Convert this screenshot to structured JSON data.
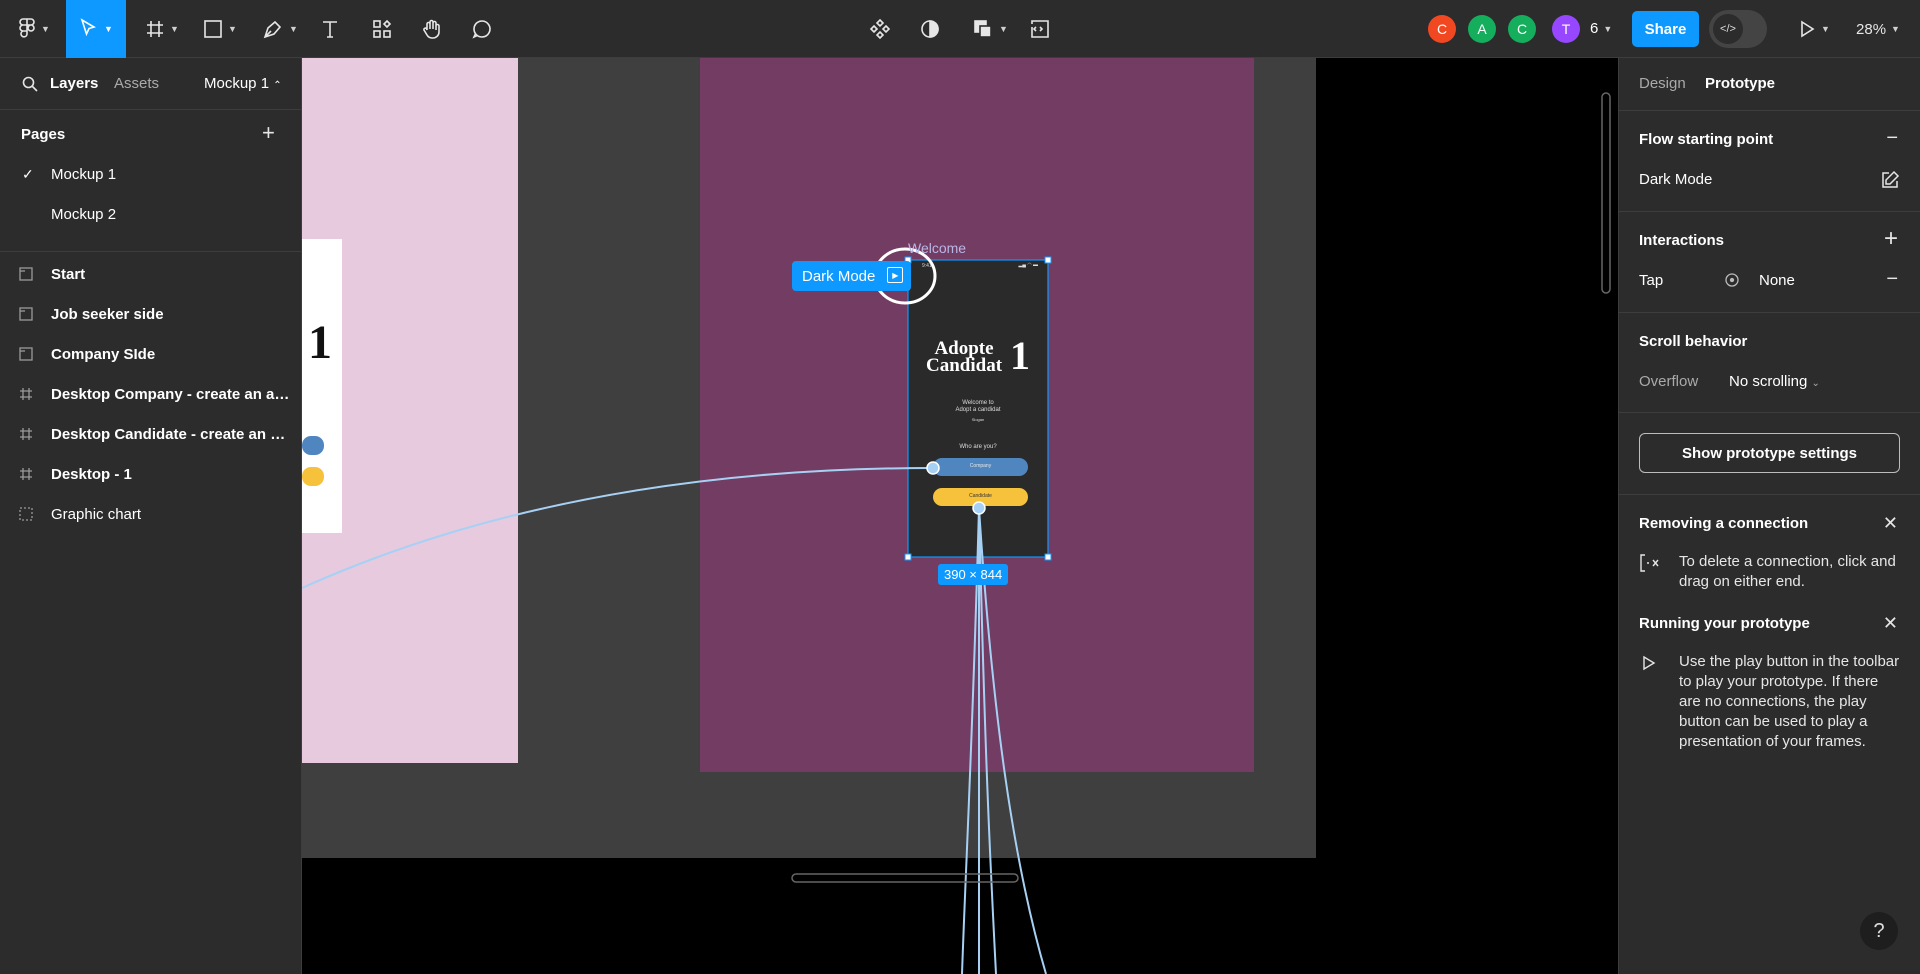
{
  "toolbar": {
    "zoom": "28%",
    "share_label": "Share",
    "collaborators": [
      {
        "initial": "C",
        "color": "#f24822"
      },
      {
        "initial": "A",
        "color": "#14ae5c"
      },
      {
        "initial": "C",
        "color": "#14ae5c"
      },
      {
        "initial": "T",
        "color": "#9747ff"
      }
    ],
    "collaborator_count": "6",
    "dev_mode_glyph": "</>"
  },
  "left_panel": {
    "tab_layers": "Layers",
    "tab_assets": "Assets",
    "page_switcher": "Mockup 1",
    "pages_title": "Pages",
    "pages": [
      "Mockup 1",
      "Mockup 2"
    ],
    "layers": [
      {
        "label": "Start",
        "icon": "section-icon"
      },
      {
        "label": "Job seeker side",
        "icon": "section-icon"
      },
      {
        "label": "Company SIde",
        "icon": "section-icon"
      },
      {
        "label": "Desktop Company - create an account",
        "icon": "frame-icon"
      },
      {
        "label": "Desktop Candidate - create an account",
        "icon": "frame-icon"
      },
      {
        "label": "Desktop - 1",
        "icon": "frame-icon"
      },
      {
        "label": "Graphic chart",
        "icon": "section-dashed-icon"
      }
    ]
  },
  "canvas": {
    "flow_label": "Dark Mode",
    "frame_name": "Welcome",
    "frame_size": "390 × 844",
    "phone": {
      "time": "9:41",
      "title_line1": "Adopte",
      "title_line2": "Candidat",
      "title_number": "1",
      "welcome_line1": "Welcome to",
      "welcome_line2": "Adopt a candidat",
      "slogan": "Slogan",
      "question": "Who are you?",
      "company_button": "Company",
      "candidate_button": "Candidate"
    },
    "left_frame_number": "1",
    "colors": {
      "purple": "#733c63",
      "pink": "#e8cade",
      "gray_bg": "#3f3f3f",
      "accent": "#0d99ff",
      "connector": "#a7d1f4",
      "yellow": "#f7c23b",
      "blue": "#4f86c0"
    }
  },
  "right_panel": {
    "tab_design": "Design",
    "tab_prototype": "Prototype",
    "flow_title": "Flow starting point",
    "flow_name": "Dark Mode",
    "interactions_title": "Interactions",
    "interaction_trigger": "Tap",
    "interaction_action": "None",
    "scroll_title": "Scroll behavior",
    "overflow_label": "Overflow",
    "overflow_value": "No scrolling",
    "settings_button": "Show prototype settings",
    "tip1_title": "Removing a connection",
    "tip1_text": "To delete a connection, click and drag on either end.",
    "tip2_title": "Running your prototype",
    "tip2_text": "Use the play button in the toolbar to play your prototype. If there are no connections, the play button can be used to play a presentation of your frames.",
    "help": "?"
  }
}
